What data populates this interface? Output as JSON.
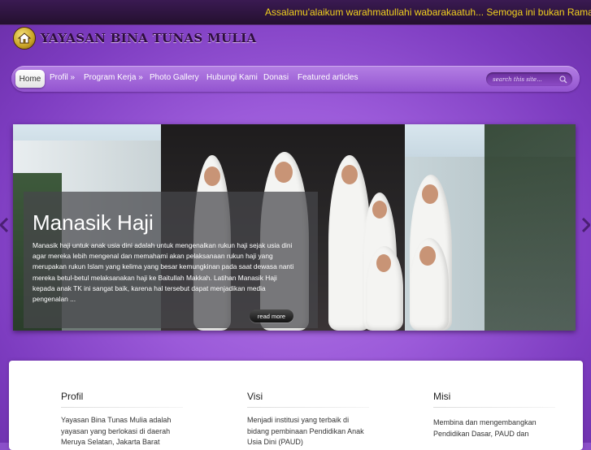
{
  "marquee": {
    "text": "Assalamu'alaikum warahmatullahi wabarakaatuh... Semoga ini bukan Ramadhan terakhir kita"
  },
  "logo": {
    "text": "YAYASAN BINA TUNAS MULIA",
    "icon": "house-logo-icon"
  },
  "nav": {
    "items": [
      {
        "label": "Home"
      },
      {
        "label": "Profil »"
      },
      {
        "label": "Program Kerja »"
      },
      {
        "label": "Photo Gallery"
      },
      {
        "label": "Hubungi Kami"
      },
      {
        "label": "Donasi"
      },
      {
        "label": "Featured articles"
      }
    ]
  },
  "search": {
    "placeholder": "search this site...",
    "icon": "search-icon"
  },
  "slider": {
    "title": "Manasik Haji",
    "body": "Manasik haji untuk anak usia dini adalah untuk mengenalkan rukun haji sejak usia dini agar mereka lebih mengenal dan memahami akan pelaksanaan rukun haji yang merupakan rukun Islam yang kelima yang besar kemungkinan pada saat dewasa nanti mereka betul-betul melaksanakan haji ke Baitullah Makkah. Latihan Manasik Haji kepada anak TK ini sangat baik, karena hal tersebut dapat menjadikan media pengenalan ...",
    "read_more": "read more"
  },
  "columns": [
    {
      "title": "Profil",
      "text": "Yayasan Bina Tunas Mulia adalah yayasan yang  berlokasi di daerah Meruya Selatan, Jakarta Barat"
    },
    {
      "title": "Visi",
      "text": "Menjadi institusi  yang terbaik di bidang  pembinaan Pendidikan Anak Usia Dini (PAUD)"
    },
    {
      "title": "Misi",
      "text": "Membina dan mengembangkan Pendidikan Dasar, PAUD dan"
    }
  ],
  "colors": {
    "accent": "#9b5ad9",
    "marquee_text": "#f2d21c",
    "nav_bar": "#a86ddd"
  }
}
